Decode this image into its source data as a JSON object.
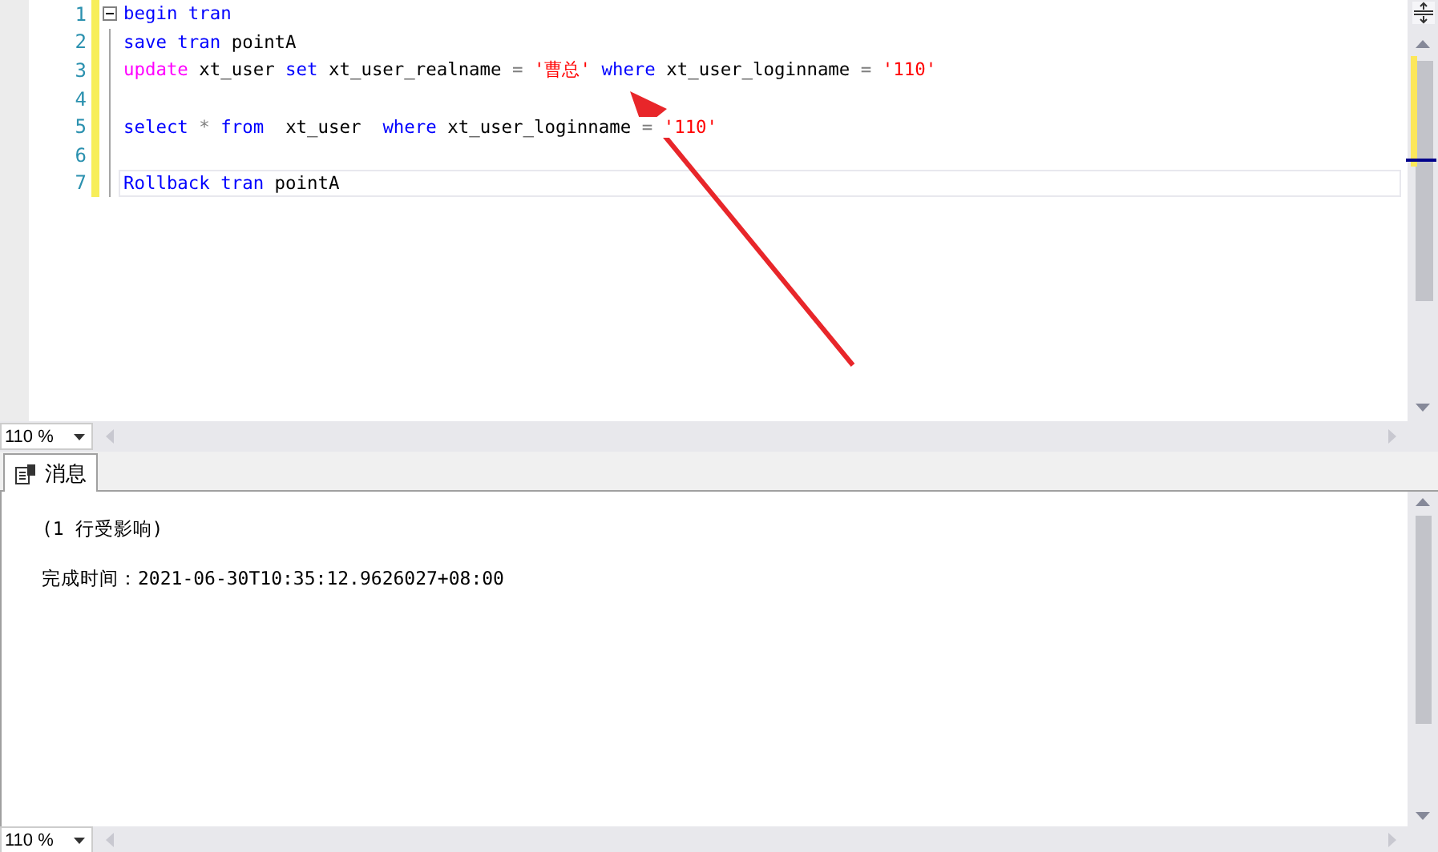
{
  "editor": {
    "lines": [
      {
        "number": "1",
        "collapsible": true,
        "current": false,
        "tokens": [
          {
            "text": "begin tran",
            "kind": "keyword"
          }
        ]
      },
      {
        "number": "2",
        "collapsible": false,
        "current": false,
        "tokens": [
          {
            "text": "save tran",
            "kind": "keyword"
          },
          {
            "text": " pointA",
            "kind": "plain"
          }
        ]
      },
      {
        "number": "3",
        "collapsible": false,
        "current": false,
        "tokens": [
          {
            "text": "update",
            "kind": "function"
          },
          {
            "text": " xt_user ",
            "kind": "plain"
          },
          {
            "text": "set",
            "kind": "keyword"
          },
          {
            "text": " xt_user_realname ",
            "kind": "plain"
          },
          {
            "text": "= ",
            "kind": "operator"
          },
          {
            "text": "'曹总' ",
            "kind": "string"
          },
          {
            "text": "where",
            "kind": "keyword"
          },
          {
            "text": " xt_user_loginname ",
            "kind": "plain"
          },
          {
            "text": "= ",
            "kind": "operator"
          },
          {
            "text": "'110'",
            "kind": "string"
          }
        ]
      },
      {
        "number": "4",
        "collapsible": false,
        "current": false
      },
      {
        "number": "5",
        "collapsible": false,
        "current": false,
        "tokens": [
          {
            "text": "select ",
            "kind": "keyword"
          },
          {
            "text": "* ",
            "kind": "operator"
          },
          {
            "text": "from",
            "kind": "keyword"
          },
          {
            "text": "  xt_user  ",
            "kind": "plain"
          },
          {
            "text": "where",
            "kind": "keyword"
          },
          {
            "text": " xt_user_loginname ",
            "kind": "plain"
          },
          {
            "text": "= ",
            "kind": "operator"
          },
          {
            "text": "'110'",
            "kind": "string"
          }
        ]
      },
      {
        "number": "6",
        "collapsible": false,
        "current": false
      },
      {
        "number": "7",
        "collapsible": false,
        "current": true,
        "tokens": [
          {
            "text": "Rollback tran",
            "kind": "keyword"
          },
          {
            "text": " pointA",
            "kind": "plain"
          }
        ]
      }
    ],
    "zoom": "110 %"
  },
  "results": {
    "tabs": [
      {
        "label": "消息",
        "selected": true
      }
    ],
    "messages": [
      "(1 行受影响)",
      "完成时间：2021-06-30T10:35:12.9626027+08:00"
    ],
    "zoom": "110 %"
  }
}
